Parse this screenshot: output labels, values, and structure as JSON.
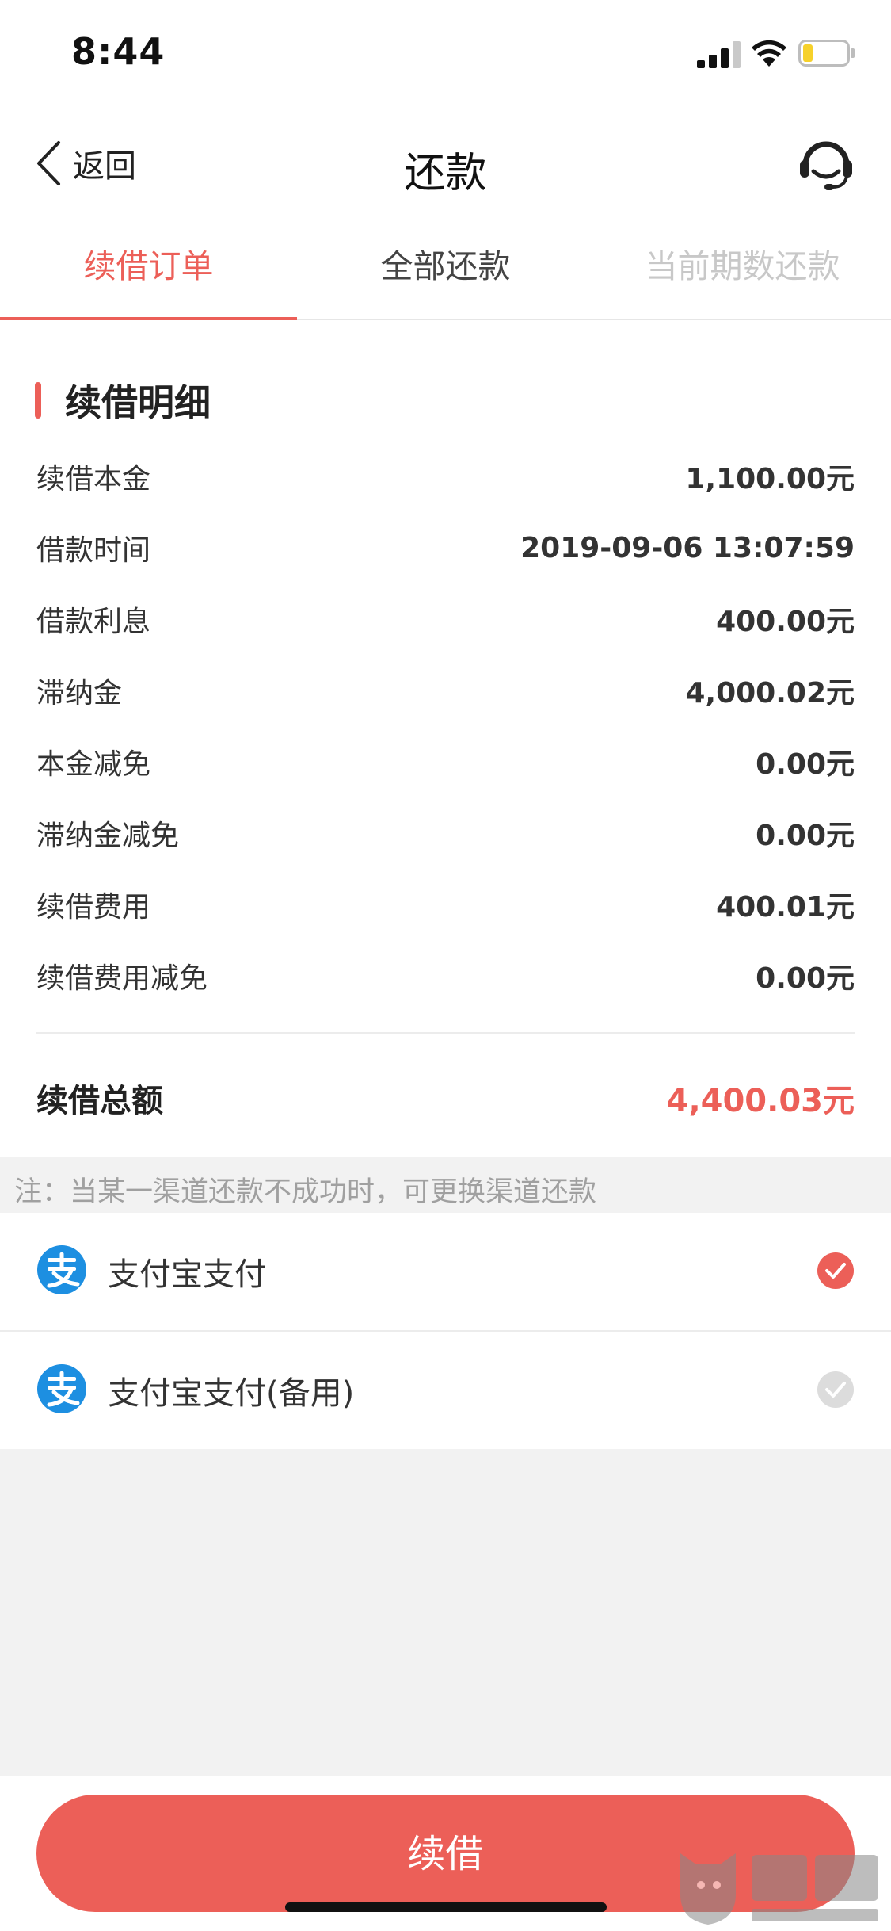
{
  "status_bar": {
    "time": "8:44",
    "icons": [
      "signal-icon",
      "wifi-icon",
      "battery-icon"
    ]
  },
  "nav": {
    "back_label": "返回",
    "title": "还款",
    "service_icon": "customer-service-icon"
  },
  "tabs": [
    {
      "label": "续借订单",
      "state": "active"
    },
    {
      "label": "全部还款",
      "state": "normal"
    },
    {
      "label": "当前期数还款",
      "state": "disabled"
    }
  ],
  "detail": {
    "title": "续借明细",
    "rows": [
      {
        "label": "续借本金",
        "value": "1,100.00元"
      },
      {
        "label": "借款时间",
        "value": "2019-09-06 13:07:59"
      },
      {
        "label": "借款利息",
        "value": "400.00元"
      },
      {
        "label": "滞纳金",
        "value": "4,000.02元"
      },
      {
        "label": "本金减免",
        "value": "0.00元"
      },
      {
        "label": "滞纳金减免",
        "value": "0.00元"
      },
      {
        "label": "续借费用",
        "value": "400.01元"
      },
      {
        "label": "续借费用减免",
        "value": "0.00元"
      }
    ],
    "total_label": "续借总额",
    "total_value": "4,400.03元"
  },
  "note": "注：当某一渠道还款不成功时，可更换渠道还款",
  "payment_options": [
    {
      "label": "支付宝支付",
      "selected": true,
      "icon": "alipay-icon"
    },
    {
      "label": "支付宝支付(备用)",
      "selected": false,
      "icon": "alipay-icon"
    }
  ],
  "action": {
    "button_label": "续借"
  },
  "colors": {
    "accent": "#ec5f58",
    "background": "#f2f2f2",
    "card": "#ffffff",
    "disabled_text": "#c8c8c8",
    "alipay_blue": "#1d8fe1"
  }
}
